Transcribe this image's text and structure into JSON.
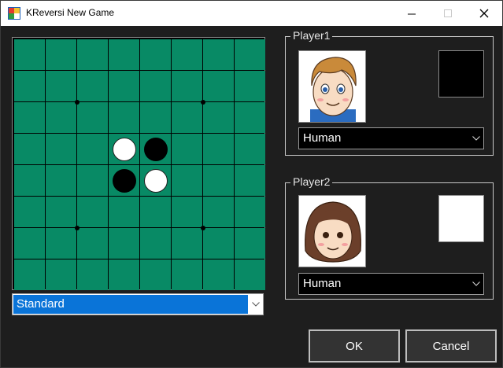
{
  "window": {
    "title": "KReversi New Game"
  },
  "board": {
    "size": 8,
    "pieces": [
      {
        "row": 3,
        "col": 3,
        "color": "white"
      },
      {
        "row": 3,
        "col": 4,
        "color": "black"
      },
      {
        "row": 4,
        "col": 3,
        "color": "black"
      },
      {
        "row": 4,
        "col": 4,
        "color": "white"
      }
    ],
    "star_points": [
      [
        2,
        2
      ],
      [
        2,
        6
      ],
      [
        6,
        2
      ],
      [
        6,
        6
      ]
    ],
    "colors": {
      "cell": "#088a65",
      "grid": "#000000"
    }
  },
  "mode": {
    "selected": "Standard"
  },
  "player1": {
    "label": "Player1",
    "type": "Human",
    "color": "#000000"
  },
  "player2": {
    "label": "Player2",
    "type": "Human",
    "color": "#ffffff"
  },
  "buttons": {
    "ok": "OK",
    "cancel": "Cancel"
  }
}
